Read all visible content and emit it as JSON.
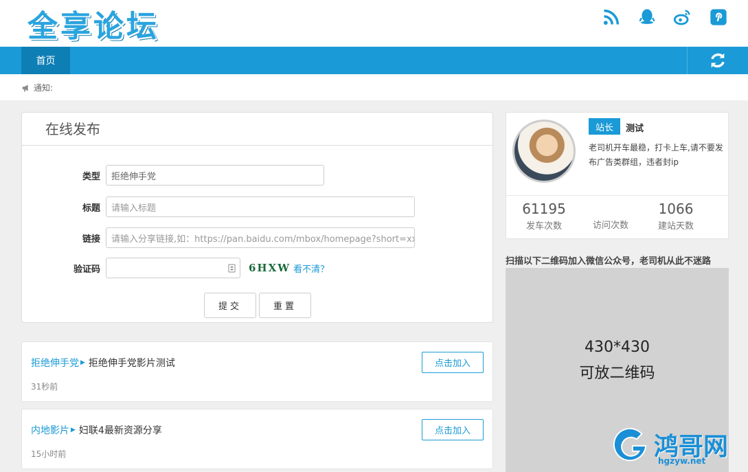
{
  "header": {
    "logo_text": "全享论坛",
    "icons": [
      "rss-icon",
      "qq-icon",
      "weibo-icon",
      "pinterest-icon"
    ]
  },
  "nav": {
    "home_label": "首页"
  },
  "notice": {
    "label": "通知:"
  },
  "publish": {
    "title": "在线发布",
    "type_label": "类型",
    "type_value": "拒绝伸手党",
    "title_label": "标题",
    "title_placeholder": "请输入标题",
    "link_label": "链接",
    "link_placeholder": "请输入分享链接,如：https://pan.baidu.com/mbox/homepage?short=xxx",
    "captcha_label": "验证码",
    "captcha_text": "6HXW",
    "captcha_refresh": "看不清？",
    "submit_label": "提交",
    "reset_label": "重置"
  },
  "posts": [
    {
      "category": "拒绝伸手党",
      "title": "拒绝伸手党影片测试",
      "time": "31秒前",
      "join_label": "点击加入"
    },
    {
      "category": "内地影片",
      "title": "妇联4最新资源分享",
      "time": "15小时前",
      "join_label": "点击加入"
    }
  ],
  "profile": {
    "role": "站长",
    "name": "测试",
    "bio": "老司机开车最稳，打卡上车,请不要发布广告类群组，违者封ip",
    "stats": [
      {
        "value": "61195",
        "label": "发车次数"
      },
      {
        "value": "",
        "label": "访问次数"
      },
      {
        "value": "1066",
        "label": "建站天数"
      }
    ]
  },
  "qr": {
    "heading": "扫描以下二维码加入微信公众号，老司机从此不迷路",
    "size_text": "430*430",
    "desc_text": "可放二维码"
  },
  "watermark": {
    "text": "鸿哥网",
    "url": "hgzyw.net"
  },
  "colors": {
    "accent": "#1a9ad6",
    "nav_active": "#0e7fb5",
    "qr_bg": "#d2d2d2"
  }
}
